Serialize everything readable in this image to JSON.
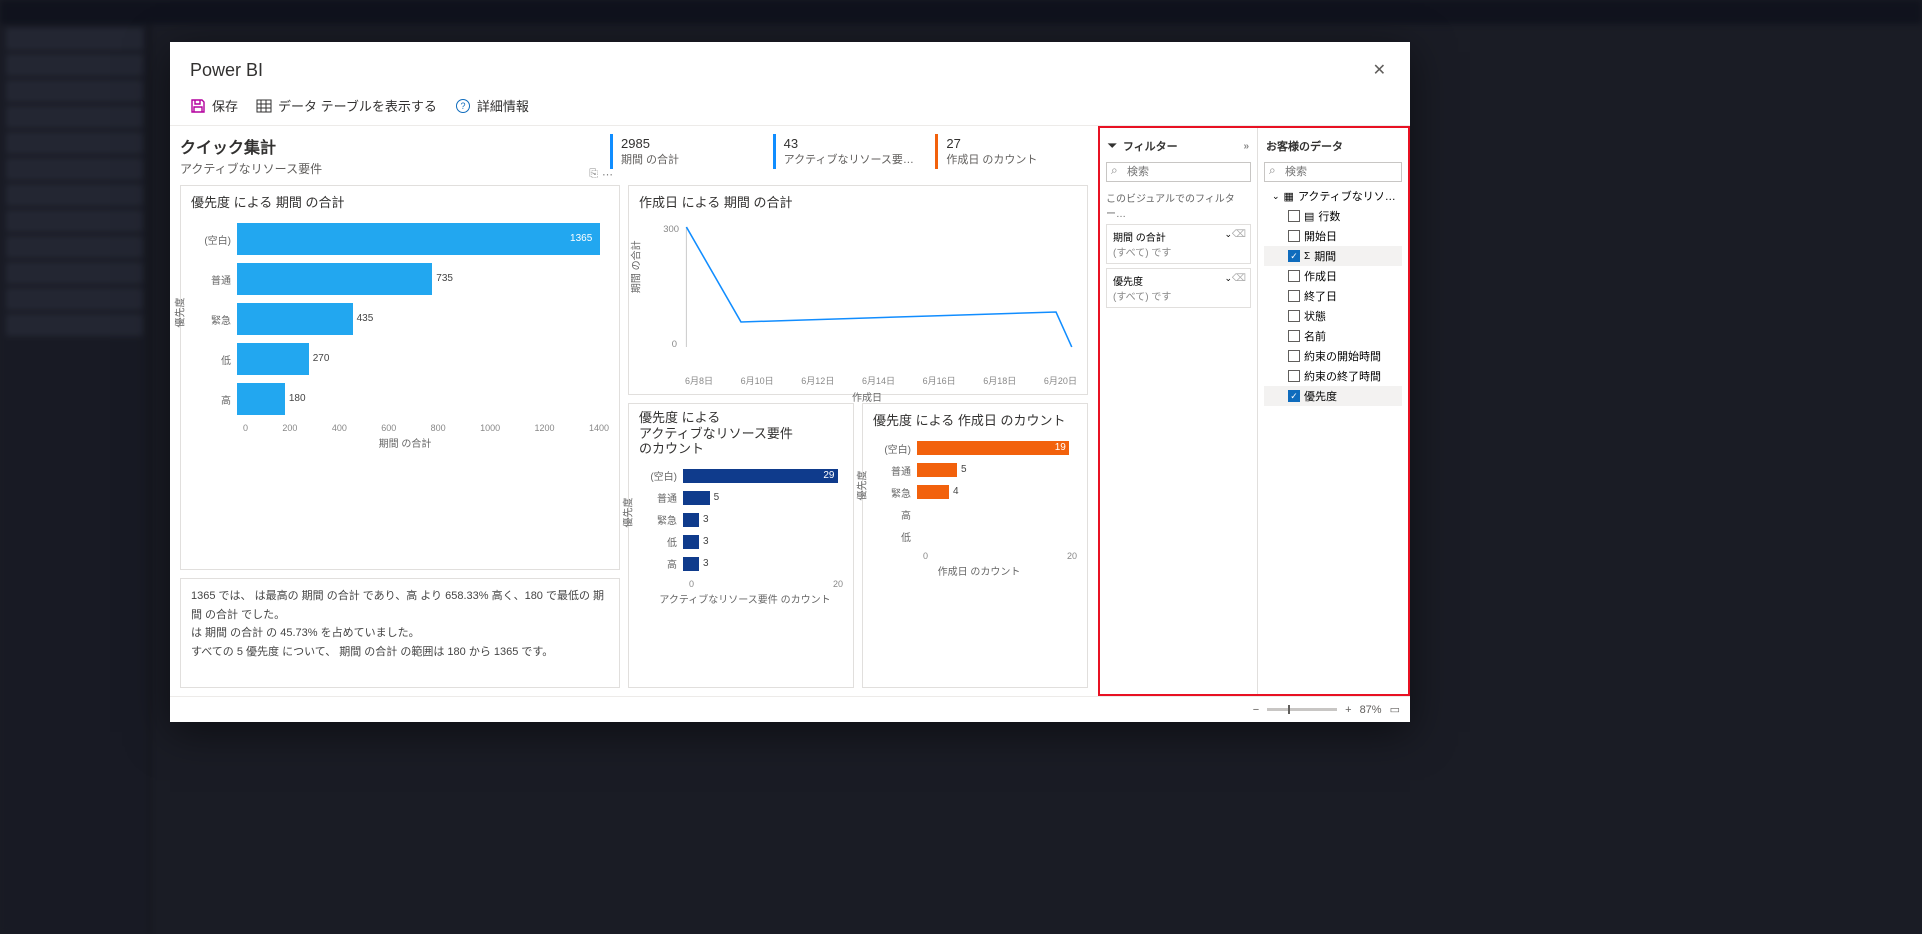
{
  "modal": {
    "title": "Power BI",
    "toolbar": {
      "save": "保存",
      "showtable": "データ テーブルを表示する",
      "details": "詳細情報"
    }
  },
  "summary": {
    "title": "クイック集計",
    "subtitle": "アクティブなリソース要件"
  },
  "kpis": [
    {
      "value": "2985",
      "label": "期間 の合計"
    },
    {
      "value": "43",
      "label": "アクティブなリソース要…"
    },
    {
      "value": "27",
      "label": "作成日 のカウント"
    }
  ],
  "insights": {
    "l1": "1365 では、  は最高の 期間 の合計 であり、高 より 658.33% 高く、180 で最低の 期間 の合計 でした。",
    "l2": " は 期間 の合計 の 45.73% を占めていました。",
    "l3": "すべての 5 優先度 について、 期間 の合計 の範囲は 180 から 1365 です。"
  },
  "chart_titles": {
    "bar1": "優先度 による 期間 の合計",
    "line": "作成日 による 期間 の合計",
    "bar2_l1": "優先度 による",
    "bar2_l2": "アクティブなリソース要件",
    "bar2_l3": "のカウント",
    "bar3": "優先度 による 作成日 のカウント"
  },
  "axis": {
    "priority": "優先度",
    "duration_sum": "期間 の合計",
    "created": "作成日",
    "active_count": "アクティブなリソース要件 のカウント",
    "created_count": "作成日 のカウント"
  },
  "filters": {
    "panel": "フィルター",
    "search": "検索",
    "onvisual": "このビジュアルでのフィルター…",
    "f1": "期間 の合計",
    "all": "(すべて) です",
    "f2": "優先度"
  },
  "yourdata": {
    "panel": "お客様のデータ",
    "search": "検索",
    "root": "アクティブなリソ…",
    "fields": {
      "rows": "行数",
      "start": "開始日",
      "duration": "期間",
      "created": "作成日",
      "end": "終了日",
      "status": "状態",
      "name": "名前",
      "apptstart": "約束の開始時間",
      "apptend": "約束の終了時間",
      "priority": "優先度"
    }
  },
  "footer": {
    "zoom": "87%"
  },
  "chart_data": [
    {
      "type": "bar",
      "orientation": "horizontal",
      "title": "優先度 による 期間 の合計",
      "categories": [
        "(空白)",
        "普通",
        "緊急",
        "低",
        "高"
      ],
      "values": [
        1365,
        735,
        435,
        270,
        180
      ],
      "xlabel": "期間 の合計",
      "ylabel": "優先度",
      "xlim": [
        0,
        1400
      ],
      "xticks": [
        0,
        200,
        400,
        600,
        800,
        1000,
        1200,
        1400
      ],
      "color": "#22a7f0"
    },
    {
      "type": "line",
      "title": "作成日 による 期間 の合計",
      "x": [
        "6月8日",
        "6月10日",
        "6月12日",
        "6月14日",
        "6月16日",
        "6月18日",
        "6月20日"
      ],
      "values": [
        300,
        105,
        110,
        115,
        120,
        125,
        130,
        0
      ],
      "xlabel": "作成日",
      "ylabel": "期間 の合計",
      "ylim": [
        0,
        300
      ],
      "yticks": [
        0,
        300
      ],
      "color": "#118dff"
    },
    {
      "type": "bar",
      "orientation": "horizontal",
      "title": "優先度 による アクティブなリソース要件 のカウント",
      "categories": [
        "(空白)",
        "普通",
        "緊急",
        "低",
        "高"
      ],
      "values": [
        29,
        5,
        3,
        3,
        3
      ],
      "xlabel": "アクティブなリソース要件 のカウント",
      "ylabel": "優先度",
      "xlim": [
        0,
        30
      ],
      "xticks": [
        0,
        20
      ],
      "color": "#0f3b8c"
    },
    {
      "type": "bar",
      "orientation": "horizontal",
      "title": "優先度 による 作成日 のカウント",
      "categories": [
        "(空白)",
        "普通",
        "緊急",
        "高",
        "低"
      ],
      "values": [
        19,
        5,
        4,
        null,
        null
      ],
      "xlabel": "作成日 のカウント",
      "ylabel": "優先度",
      "xlim": [
        0,
        20
      ],
      "xticks": [
        0,
        20
      ],
      "color": "#f2610c"
    }
  ]
}
